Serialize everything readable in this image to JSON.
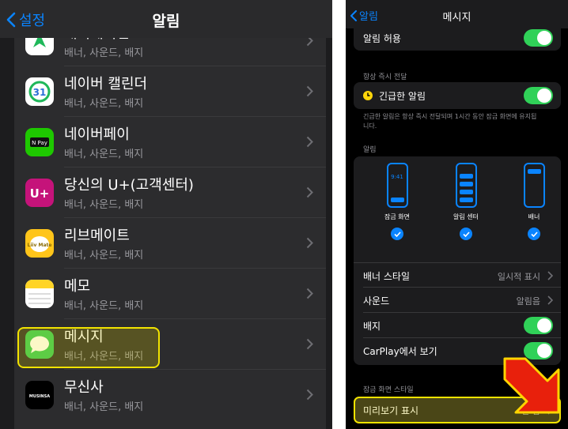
{
  "left": {
    "nav": {
      "back_label": "설정",
      "title": "알림"
    },
    "rows": [
      {
        "name": "내비게이션",
        "sub": "배너, 사운드, 배지",
        "icon": "tmap-navigation-icon"
      },
      {
        "name": "네이버 캘린더",
        "sub": "배너, 사운드, 배지",
        "icon": "naver-calendar-icon",
        "icon_text": "31"
      },
      {
        "name": "네이버페이",
        "sub": "배너, 사운드, 배지",
        "icon": "naver-pay-icon",
        "icon_text": "N Pay"
      },
      {
        "name": "당신의 U+(고객센터)",
        "sub": "배너, 사운드, 배지",
        "icon": "uplus-icon",
        "icon_text": "U+"
      },
      {
        "name": "리브메이트",
        "sub": "배너, 사운드, 배지",
        "icon": "liivmate-icon",
        "icon_text": "Liiv Mate"
      },
      {
        "name": "메모",
        "sub": "배너, 사운드, 배지",
        "icon": "notes-icon"
      },
      {
        "name": "메시지",
        "sub": "배너, 사운드, 배지",
        "icon": "messages-icon"
      },
      {
        "name": "무신사",
        "sub": "배너, 사운드, 배지",
        "icon": "musinsa-icon",
        "icon_text": "MUSINSA"
      }
    ]
  },
  "right": {
    "nav": {
      "back_label": "알림",
      "title": "메시지"
    },
    "allow_label": "알림 허용",
    "always_section": "항상 즉시 전달",
    "urgent_label": "긴급한 알림",
    "urgent_note": "긴급한 알림은 항상 즉시 전달되며 1시간 동안 잠금 화면에 유지됩니다.",
    "alerts_section": "알림",
    "lock_time": "9:41",
    "styles": [
      {
        "label": "잠금 화면",
        "checked": true
      },
      {
        "label": "알림 센터",
        "checked": true
      },
      {
        "label": "배너",
        "checked": true
      }
    ],
    "banner_style_label": "배너 스타일",
    "banner_style_value": "일시적 표시",
    "sound_label": "사운드",
    "sound_value": "알림음",
    "badge_label": "배지",
    "carplay_label": "CarPlay에서 보기",
    "lock_section": "잠금 화면 스타일",
    "preview_label": "미리보기 표시",
    "preview_value": "안 함"
  },
  "colors": {
    "accent": "#0a84ff",
    "toggle_on": "#30d158",
    "highlight": "#f2e300",
    "arrow": "#e8200c"
  }
}
